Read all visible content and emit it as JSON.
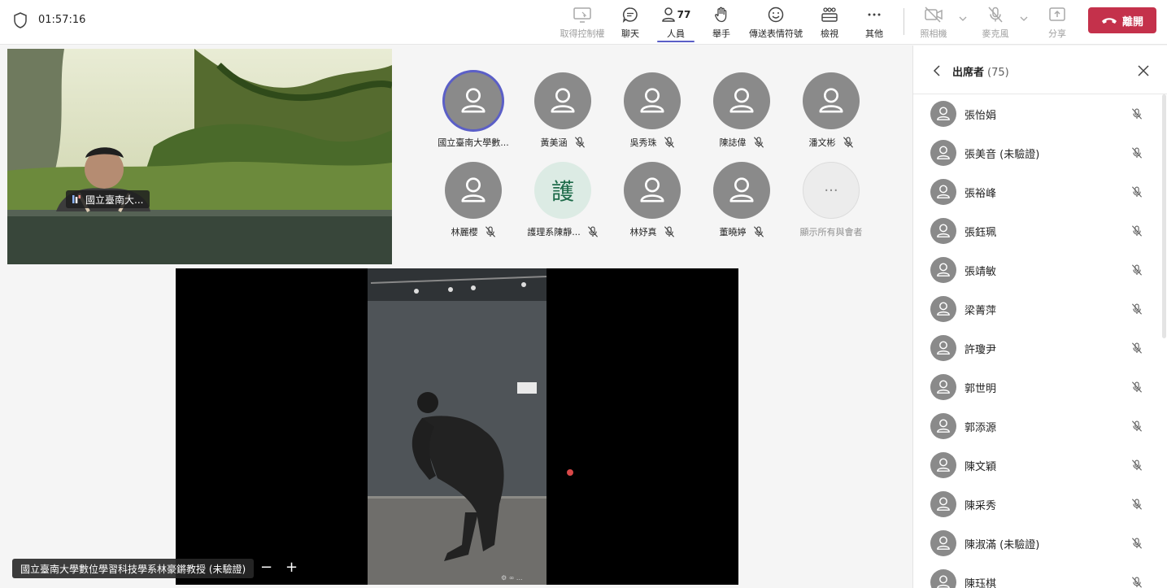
{
  "timer": "01:57:16",
  "toolbar": {
    "take_control": "取得控制權",
    "chat": "聊天",
    "people": "人員",
    "people_count": "77",
    "raise_hand": "舉手",
    "reactions": "傳送表情符號",
    "view": "檢視",
    "more": "其他",
    "camera": "照相機",
    "mic": "麥克風",
    "share": "分享",
    "leave": "離開"
  },
  "self_video": {
    "name": "國立臺南大..."
  },
  "tiles": [
    {
      "name": "國立臺南大學數...",
      "muted": false,
      "active": true,
      "initial": ""
    },
    {
      "name": "黃美涵",
      "muted": true,
      "active": false,
      "initial": ""
    },
    {
      "name": "吳秀珠",
      "muted": true,
      "active": false,
      "initial": ""
    },
    {
      "name": "陳誌偉",
      "muted": true,
      "active": false,
      "initial": ""
    },
    {
      "name": "潘文彬",
      "muted": true,
      "active": false,
      "initial": ""
    },
    {
      "name": "林麗櫻",
      "muted": true,
      "active": false,
      "initial": ""
    },
    {
      "name": "護理系陳靜...",
      "muted": true,
      "active": false,
      "initial": "護"
    },
    {
      "name": "林妤真",
      "muted": true,
      "active": false,
      "initial": ""
    },
    {
      "name": "董曉婷",
      "muted": true,
      "active": false,
      "initial": ""
    }
  ],
  "show_all": {
    "label": "顯示所有與會者",
    "glyph": "···"
  },
  "share_label": "國立臺南大學數位學習科技學系林豪鏘教授 (未驗證)",
  "zoom": {
    "minus": "−",
    "plus": "+"
  },
  "panel": {
    "title": "出席者",
    "count": "(75)",
    "attendees": [
      "張怡娟",
      "張美音 (未驗證)",
      "張裕峰",
      "張鈺珮",
      "張靖敏",
      "梁菁萍",
      "許瓊尹",
      "郭世明",
      "郭添源",
      "陳文穎",
      "陳采秀",
      "陳淑滿 (未驗證)",
      "陳珏棋"
    ]
  },
  "colors": {
    "accent": "#5b5fc7",
    "leave": "#c4314b"
  }
}
